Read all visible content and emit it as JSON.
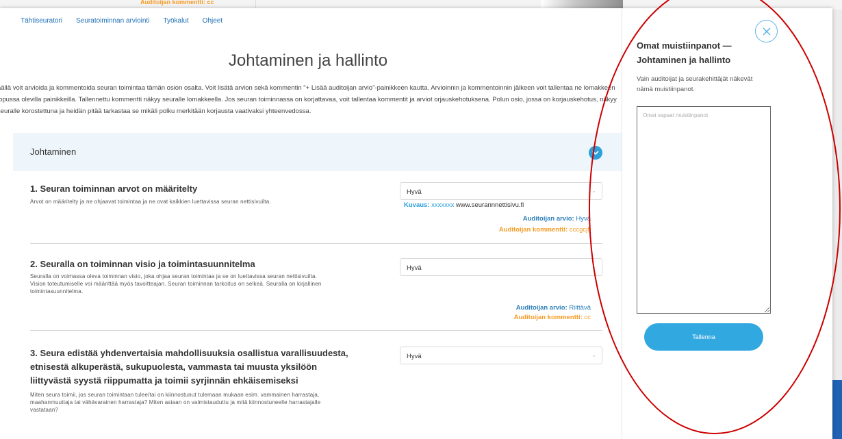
{
  "backdrop": {
    "comment_label": "Auditoijan kommentti:",
    "comment_value": "cc"
  },
  "nav": {
    "items": [
      "Tähtiseuratori",
      "Seuratoiminnan arviointi",
      "Työkalut",
      "Ohjeet"
    ]
  },
  "page": {
    "title": "Johtaminen ja hallinto",
    "intro": "äällä voit arvioida ja kommentoida seuran toimintaa tämän osion osalta. Voit lisätä arvion sekä kommentin \"+ Lisää auditoijan arvio\"-painikkeen kautta. Arvioinnin ja kommentoinnin jälkeen voit tallentaa ne lomakkeen lopussa olevilla painikkeilla. Tallennettu kommentti näkyy seuralle lomakkeella. Jos seuran toiminnassa on korjattavaa, voit tallentaa kommentit ja arviot orjauskehotuksena. Polun osio, jossa on korjauskehotus, näkyy seuralle korostettuna ja heidän pitää tarkastaa se mikäli polku merkitään korjausta vaativaksi yhteenvedossa."
  },
  "section": {
    "title": "Johtaminen"
  },
  "questions": [
    {
      "title": "1. Seuran toiminnan arvot on määritelty",
      "description": "Arvot on määritelty ja ne ohjaavat toimintaa ja ne ovat kaikkien luettavissa seuran nettisivuilta.",
      "selected": "Hyvä",
      "kuvaus_label": "Kuvaus:",
      "kuvaus_code": "xxxxxxx",
      "kuvaus_url": "www.seurannnettisivu.fi",
      "auditor_rating_label": "Auditoijan arvio:",
      "auditor_rating": "Hyvä",
      "auditor_comment_label": "Auditoijan kommentti:",
      "auditor_comment": "cccgcjfj"
    },
    {
      "title": "2. Seuralla on toiminnan visio ja toimintasuunnitelma",
      "description": "Seuralla on voimassa oleva toiminnan visio, joka ohjaa seuran toimintaa ja se on luettavissa seuran nettisivuilta. Vision toteutumiselle voi määrittää myös tavoitteajan. Seuran toiminnan tarkoitus on selkeä. Seuralla on kirjallinen toimintasuunnitelma.",
      "selected": "Hyvä",
      "auditor_rating_label": "Auditoijan arvio:",
      "auditor_rating": "Riittävä",
      "auditor_comment_label": "Auditoijan kommentti:",
      "auditor_comment": "cc"
    },
    {
      "title": "3. Seura edistää yhdenvertaisia mahdollisuuksia osallistua varallisuudesta, etnisestä alkuperästä, sukupuolesta, vammasta tai muusta yksilöön liittyvästä syystä riippumatta ja toimii syrjinnän ehkäisemiseksi",
      "description": "Miten seura toimii, jos seuran toimintaan tulee/tai on kiinnostunut tulemaan mukaan esim. vammainen harrastaja, maahanmuuttaja tai vähävarainen harrastaja? Miten asiaan on valmistauduttu ja mitä kiinnostuneelle harrastajalle vastataan?",
      "selected": "Hyvä"
    }
  ],
  "notes": {
    "title": "Omat muistiinpanot — Johtaminen ja hallinto",
    "subtitle": "Vain auditoijat ja seurakehittäjät näkevät nämä muistiinpanot.",
    "placeholder": "Omat vapaat muistiinpanot",
    "save_label": "Tallenna"
  },
  "colors": {
    "link": "#1f6fb5",
    "accent": "#2d9fd9",
    "auditor_blue": "#2c7fb8",
    "auditor_orange": "#f59a23",
    "annotation_red": "#cc0000"
  },
  "icons": {
    "close": "close-icon",
    "chevron": "chevron-down-icon"
  }
}
